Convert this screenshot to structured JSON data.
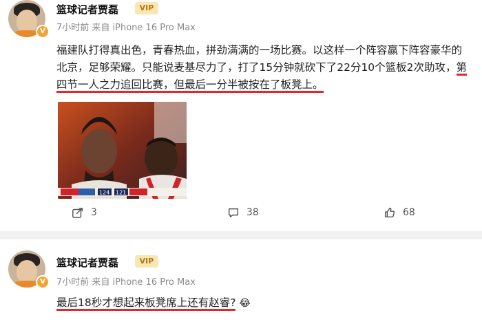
{
  "post1": {
    "username": "篮球记者贾磊",
    "badge": "V",
    "crown_label": "VIP",
    "meta": "7小时前  来自 iPhone 16 Pro Max",
    "text_plain": "福建队打得真出色，青春热血，拼劲满满的一场比赛。以这样一个阵容赢下阵容豪华的北京，足够荣耀。只能说麦基尽力了，打了15分钟就砍下了22分10个篮板2次助攻，",
    "text_highlight": "第四节一人之力追回比赛，但最后一分半被按在了板凳上。",
    "scoreboard": {
      "score_a": "124",
      "score_b": "121"
    },
    "actions": {
      "share_count": "3",
      "comment_count": "38",
      "like_count": "68"
    }
  },
  "post2": {
    "username": "篮球记者贾磊",
    "badge": "V",
    "crown_label": "VIP",
    "meta": "7小时前  来自 iPhone 16 Pro Max",
    "text": "最后18秒才想起来板凳席上还有赵睿?",
    "emoji": "😂"
  },
  "colors": {
    "highlight_red": "#e8262a",
    "badge_orange": "#f3a533",
    "meta_gray": "#8a8a8a"
  }
}
